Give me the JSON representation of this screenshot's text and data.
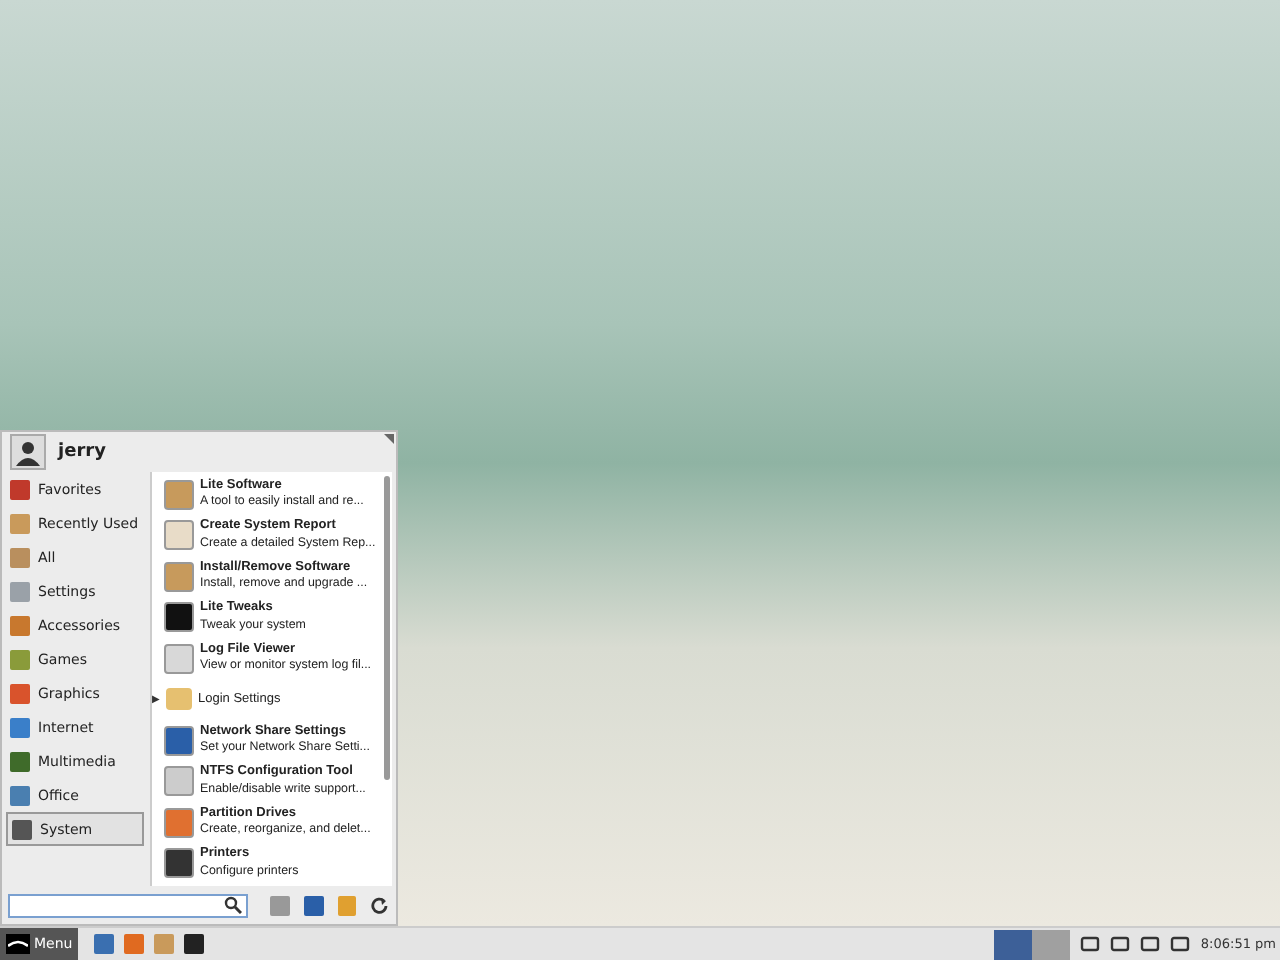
{
  "menu": {
    "user": "jerry",
    "categories": [
      {
        "label": "Favorites",
        "selected": false
      },
      {
        "label": "Recently Used",
        "selected": false
      },
      {
        "label": "All",
        "selected": false
      },
      {
        "label": "Settings",
        "selected": false
      },
      {
        "label": "Accessories",
        "selected": false
      },
      {
        "label": "Games",
        "selected": false
      },
      {
        "label": "Graphics",
        "selected": false
      },
      {
        "label": "Internet",
        "selected": false
      },
      {
        "label": "Multimedia",
        "selected": false
      },
      {
        "label": "Office",
        "selected": false
      },
      {
        "label": "System",
        "selected": true
      }
    ],
    "apps": [
      {
        "kind": "app",
        "name": "Lite Software",
        "description": "A tool to easily install and re..."
      },
      {
        "kind": "app",
        "name": "Create System Report",
        "description": "Create a detailed System Rep..."
      },
      {
        "kind": "app",
        "name": "Install/Remove Software",
        "description": "Install, remove and upgrade ..."
      },
      {
        "kind": "app",
        "name": "Lite Tweaks",
        "description": "Tweak your system"
      },
      {
        "kind": "app",
        "name": "Log File Viewer",
        "description": "View or monitor system log fil..."
      },
      {
        "kind": "submenu",
        "name": "Login Settings",
        "arrow": "▶"
      },
      {
        "kind": "app",
        "name": "Network Share Settings",
        "description": "Set your Network Share Setti..."
      },
      {
        "kind": "app",
        "name": "NTFS Configuration Tool",
        "description": "Enable/disable write support..."
      },
      {
        "kind": "app",
        "name": "Partition Drives",
        "description": "Create, reorganize, and delet..."
      },
      {
        "kind": "app",
        "name": "Printers",
        "description": "Configure printers"
      }
    ]
  },
  "taskbar": {
    "menu_label": "Menu",
    "workspaces": [
      {
        "selected": true
      },
      {
        "selected": false
      }
    ],
    "clock": "8:06:51 pm"
  }
}
